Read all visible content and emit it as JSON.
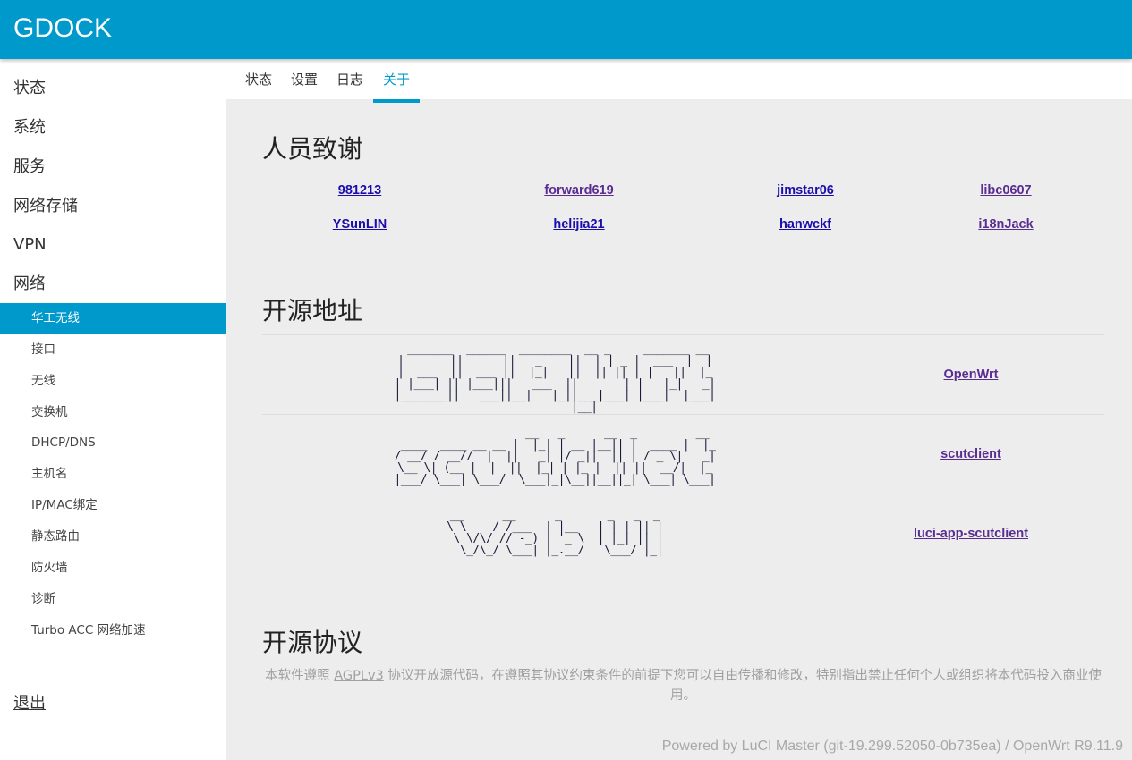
{
  "brand": "GDOCK",
  "sidebar": {
    "top_items": [
      {
        "label": "状态"
      },
      {
        "label": "系统"
      },
      {
        "label": "服务"
      },
      {
        "label": "网络存储"
      },
      {
        "label": "VPN"
      },
      {
        "label": "网络"
      }
    ],
    "network_items": [
      {
        "label": "华工无线",
        "active": true
      },
      {
        "label": "接口"
      },
      {
        "label": "无线"
      },
      {
        "label": "交换机"
      },
      {
        "label": "DHCP/DNS"
      },
      {
        "label": "主机名"
      },
      {
        "label": "IP/MAC绑定"
      },
      {
        "label": "静态路由"
      },
      {
        "label": "防火墙"
      },
      {
        "label": "诊断"
      },
      {
        "label": "Turbo ACC 网络加速"
      }
    ],
    "logout": "退出"
  },
  "tabs": [
    {
      "label": "状态"
    },
    {
      "label": "设置"
    },
    {
      "label": "日志"
    },
    {
      "label": "关于",
      "active": true
    }
  ],
  "thanks": {
    "title": "人员致谢",
    "contributors": [
      "981213",
      "forward619",
      "jimstar06",
      "libc0607",
      "YSunLIN",
      "helijia21",
      "hanwckf",
      "i18nJack"
    ]
  },
  "sources": {
    "title": "开源地址",
    "projects": [
      {
        "art": " _______  ______  ________  __ _     _______ __\n|       ||      ||   _    ||  | | _ |  ___  |  |\n|  ___  ||  ___ ||  |_|   ||  || || | |   ||  |_\n| |___| || |___|||   ___  ||       | |   |_|   _|\n|_______||   ___||__|   |_||___|___| |___|  |___|\n         |__|",
        "link": "OpenWrt"
      },
      {
        "art": "                   __   _      __  _         __\n ____  ____ __ __ |  |_| | __ |__|| |  ____ |  |_\n/ __/ / __//  |  ||   _| |/ _||  || | / _ \\|   _|\n\\__ \\| (__ |  |  ||  |_| | |_ |  || ||  __/|  |_\n|___/ \\___| \\___/  \\___|_|\\__||__||_| \\___| \\___|",
        "link": "scutclient"
      },
      {
        "art": "__      __      _       _   _  _\n\\ \\    / /___  | |__   | | | || |\n \\ \\/\\/ // -_) | '_ \\  | |_| || |\n  \\_/\\_/ \\___| |_.__/   \\___/ |_|",
        "link": "luci-app-scutclient"
      }
    ]
  },
  "license": {
    "title": "开源协议",
    "prefix": "本软件遵照 ",
    "link": "AGPLv3",
    "suffix": " 协议开放源代码，在遵照其协议约束条件的前提下您可以自由传播和修改，特别指出禁止任何个人或组织将本代码投入商业使用。"
  },
  "footer": "Powered by LuCI Master (git-19.299.52050-0b735ea) / OpenWrt R9.11.9",
  "colors": {
    "accent": "#0099cc",
    "link": "#1a0dab",
    "visited_link": "#5a2d91"
  }
}
